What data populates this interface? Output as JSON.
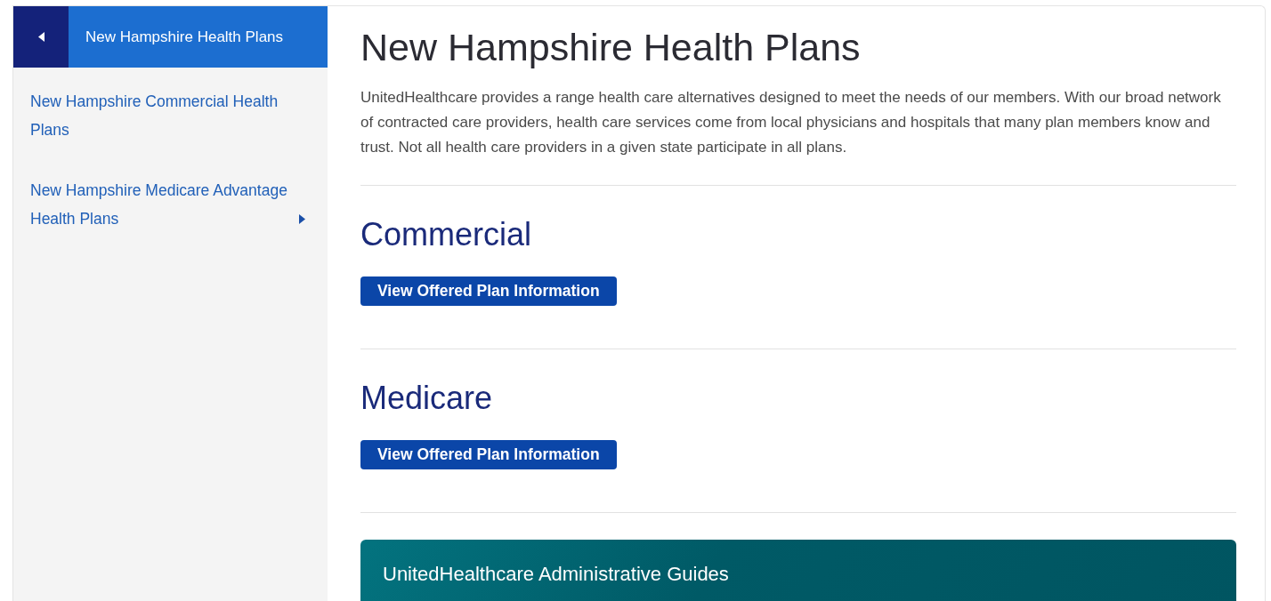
{
  "sidebar": {
    "header": {
      "title": "New Hampshire Health Plans"
    },
    "items": [
      {
        "label": "New Hampshire Commercial Health Plans",
        "has_submenu": false
      },
      {
        "label": "New Hampshire Medicare Advantage Health Plans",
        "has_submenu": true
      }
    ]
  },
  "main": {
    "title": "New Hampshire Health Plans",
    "intro": "UnitedHealthcare provides a range health care alternatives designed to meet the needs of our members. With our broad network of contracted care providers, health care services come from local physicians and hospitals that many plan members know and trust. Not all health care providers in a given state participate in all plans.",
    "sections": [
      {
        "heading": "Commercial",
        "button": "View Offered Plan Information"
      },
      {
        "heading": "Medicare",
        "button": "View Offered Plan Information"
      }
    ],
    "banner": {
      "title": "UnitedHealthcare Administrative Guides"
    }
  }
}
